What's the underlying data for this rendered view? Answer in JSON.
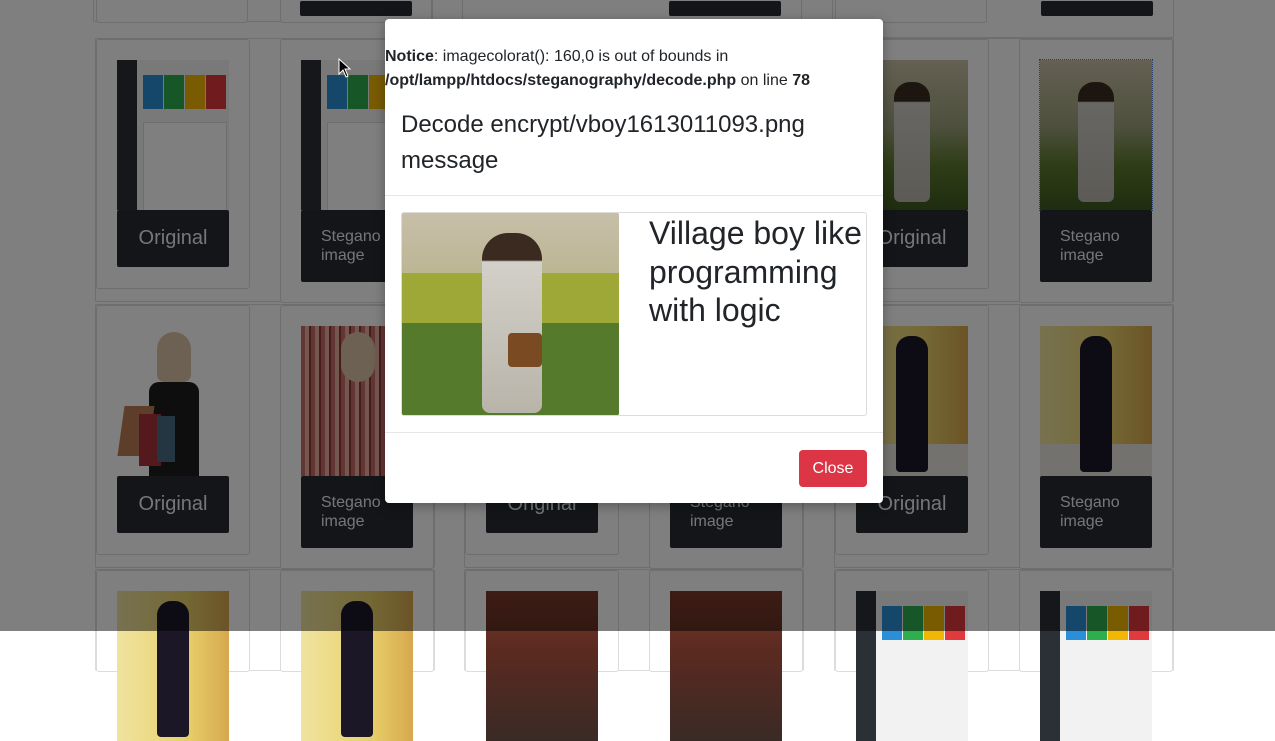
{
  "gallery": {
    "original_label": "Original",
    "stegano_label": "Stegano image"
  },
  "modal": {
    "notice": {
      "prefix": "Notice",
      "message": ": imagecolorat(): 160,0 is out of bounds in ",
      "path": "/opt/lampp/htdocs/steganography/decode.php",
      "on_line_text": " on line ",
      "line_number": "78"
    },
    "title": "Decode encrypt/vboy1613011093.png message",
    "decoded_message": "Village boy like programming with logic",
    "close_label": "Close"
  },
  "colors": {
    "close_button": "#dc3545",
    "caption_bg": "#262b30",
    "backdrop": "rgba(0,0,0,0.5)"
  }
}
